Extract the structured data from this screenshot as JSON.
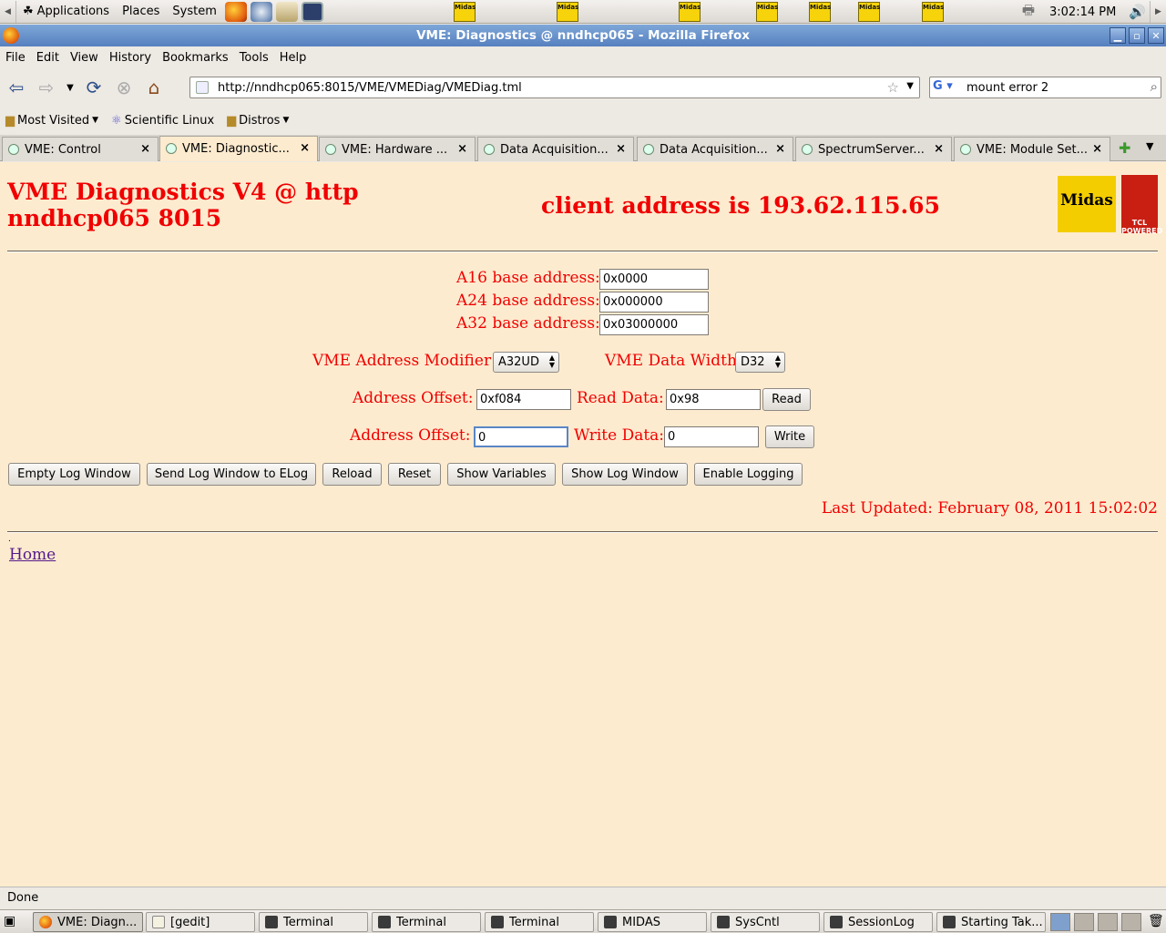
{
  "panel": {
    "menus": [
      "Applications",
      "Places",
      "System"
    ],
    "clock": "3:02:14 PM",
    "midas_launchers": [
      "Midas",
      "Midas",
      "Midas",
      "Midas",
      "Midas",
      "Midas",
      "Midas"
    ]
  },
  "window": {
    "title": "VME: Diagnostics @ nndhcp065 - Mozilla Firefox"
  },
  "menubar": [
    "File",
    "Edit",
    "View",
    "History",
    "Bookmarks",
    "Tools",
    "Help"
  ],
  "navigation": {
    "url": "http://nndhcp065:8015/VME/VMEDiag/VMEDiag.tml",
    "search_text": "mount error 2"
  },
  "bookmarks": [
    "Most Visited",
    "Scientific Linux",
    "Distros"
  ],
  "tabs": [
    {
      "label": "VME: Control"
    },
    {
      "label": "VME: Diagnostic..."
    },
    {
      "label": "VME: Hardware ..."
    },
    {
      "label": "Data Acquisition..."
    },
    {
      "label": "Data Acquisition..."
    },
    {
      "label": "SpectrumServer..."
    },
    {
      "label": "VME: Module Set..."
    }
  ],
  "page": {
    "title": "VME Diagnostics V4 @ http nndhcp065 8015",
    "client_address": "client address is 193.62.115.65",
    "logos": {
      "midas": "Midas",
      "tcl": "TCL POWERED"
    },
    "base": {
      "a16_label": "A16 base address:",
      "a16_value": "0x0000",
      "a24_label": "A24 base address:",
      "a24_value": "0x000000",
      "a32_label": "A32 base address:",
      "a32_value": "0x03000000"
    },
    "modifier_label": "VME Address Modifier",
    "modifier_value": "A32UD",
    "width_label": "VME Data Width",
    "width_value": "D32",
    "read": {
      "offset_label": "Address Offset:",
      "offset_value": "0xf084",
      "data_label": "Read Data:",
      "data_value": "0x98",
      "button": "Read"
    },
    "write": {
      "offset_label": "Address Offset:",
      "offset_value": "0",
      "data_label": "Write Data:",
      "data_value": "0",
      "button": "Write"
    },
    "buttons": [
      "Empty Log Window",
      "Send Log Window to ELog",
      "Reload",
      "Reset",
      "Show Variables",
      "Show Log Window",
      "Enable Logging"
    ],
    "last_updated": "Last Updated: February 08, 2011 15:02:02",
    "dot": ".",
    "home_link": "Home"
  },
  "status": "Done",
  "taskbar": [
    {
      "label": "VME: Diagn..."
    },
    {
      "label": "[gedit]"
    },
    {
      "label": "Terminal"
    },
    {
      "label": "Terminal"
    },
    {
      "label": "Terminal"
    },
    {
      "label": "MIDAS"
    },
    {
      "label": "SysCntl"
    },
    {
      "label": "SessionLog"
    },
    {
      "label": "Starting Tak..."
    }
  ]
}
